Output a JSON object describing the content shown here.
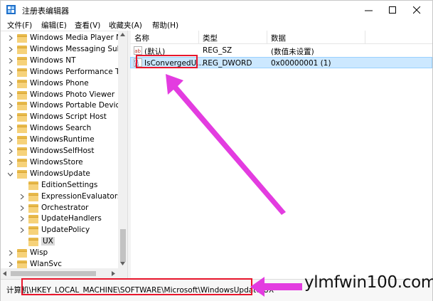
{
  "window": {
    "title": "注册表编辑器"
  },
  "menu": [
    "文件(F)",
    "编辑(E)",
    "查看(V)",
    "收藏夹(A)",
    "帮助(H)"
  ],
  "tree": {
    "items": [
      {
        "label": "Windows Media Player NSS",
        "level": 1,
        "expander": "collapsed"
      },
      {
        "label": "Windows Messaging Subsystem",
        "level": 1,
        "expander": "collapsed"
      },
      {
        "label": "Windows NT",
        "level": 1,
        "expander": "collapsed"
      },
      {
        "label": "Windows Performance Toolkit",
        "level": 1,
        "expander": "collapsed"
      },
      {
        "label": "Windows Phone",
        "level": 1,
        "expander": "collapsed"
      },
      {
        "label": "Windows Photo Viewer",
        "level": 1,
        "expander": "collapsed"
      },
      {
        "label": "Windows Portable Devices",
        "level": 1,
        "expander": "collapsed"
      },
      {
        "label": "Windows Script Host",
        "level": 1,
        "expander": "collapsed"
      },
      {
        "label": "Windows Search",
        "level": 1,
        "expander": "collapsed"
      },
      {
        "label": "WindowsRuntime",
        "level": 1,
        "expander": "collapsed"
      },
      {
        "label": "WindowsSelfHost",
        "level": 1,
        "expander": "collapsed"
      },
      {
        "label": "WindowsStore",
        "level": 1,
        "expander": "collapsed"
      },
      {
        "label": "WindowsUpdate",
        "level": 1,
        "expander": "expanded"
      },
      {
        "label": "EditionSettings",
        "level": 2,
        "expander": "none"
      },
      {
        "label": "ExpressionEvaluators",
        "level": 2,
        "expander": "collapsed"
      },
      {
        "label": "Orchestrator",
        "level": 2,
        "expander": "collapsed"
      },
      {
        "label": "UpdateHandlers",
        "level": 2,
        "expander": "collapsed"
      },
      {
        "label": "UpdatePolicy",
        "level": 2,
        "expander": "collapsed"
      },
      {
        "label": "UX",
        "level": 2,
        "expander": "none",
        "selected": true
      },
      {
        "label": "Wisp",
        "level": 1,
        "expander": "collapsed"
      },
      {
        "label": "WlanSvc",
        "level": 1,
        "expander": "collapsed"
      }
    ]
  },
  "list": {
    "columns": {
      "name": "名称",
      "type": "类型",
      "data": "数据"
    },
    "rows": [
      {
        "icon": "string-value-icon",
        "name": "(默认)",
        "type": "REG_SZ",
        "data": "(数值未设置)"
      },
      {
        "icon": "dword-value-icon",
        "name": "IsConvergedU...",
        "type": "REG_DWORD",
        "data": "0x00000001 (1)",
        "selected": true
      }
    ]
  },
  "status": {
    "prefix": "计算机",
    "path": "\\HKEY_LOCAL_MACHINE\\SOFTWARE\\Microsoft\\WindowsUpdate\\UX"
  },
  "watermark": "ylmfwin100.com",
  "colors": {
    "highlight": "#e8162c",
    "arrow": "#e33ce0",
    "selection": "#cce8ff",
    "folder": "#f6d27a"
  }
}
